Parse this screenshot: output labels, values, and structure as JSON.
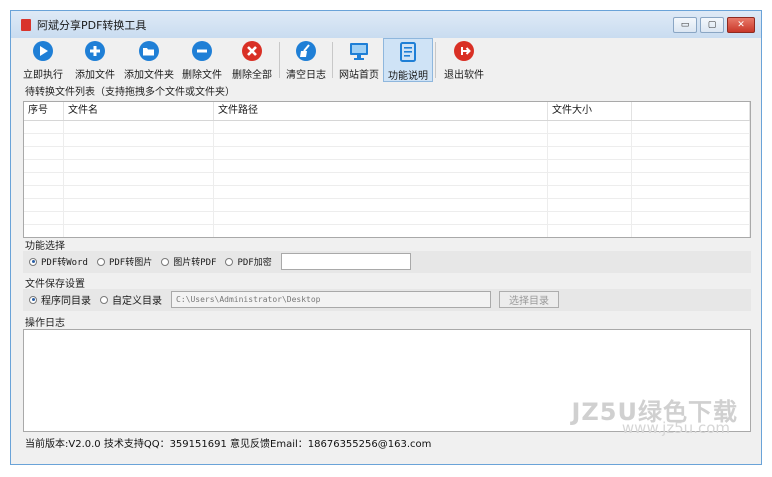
{
  "window": {
    "title": "阿斌分享PDF转换工具",
    "controls": {
      "minimize": "▭",
      "maximize": "▢",
      "close": "✕"
    }
  },
  "toolbar": {
    "items": [
      {
        "label": "立即执行",
        "icon": "play-icon",
        "color": "#1f7fd6"
      },
      {
        "label": "添加文件",
        "icon": "plus-icon",
        "color": "#1f7fd6"
      },
      {
        "label": "添加文件夹",
        "icon": "folder-icon",
        "color": "#1f7fd6"
      },
      {
        "label": "删除文件",
        "icon": "minus-icon",
        "color": "#1f7fd6"
      },
      {
        "label": "删除全部",
        "icon": "delete-all-icon",
        "color": "#d93025"
      },
      {
        "label": "清空日志",
        "icon": "broom-icon",
        "color": "#1f7fd6"
      },
      {
        "label": "网站首页",
        "icon": "monitor-icon",
        "color": "#1f7fd6"
      },
      {
        "label": "功能说明",
        "icon": "document-icon",
        "color": "#1f7fd6"
      },
      {
        "label": "退出软件",
        "icon": "exit-icon",
        "color": "#d93025"
      }
    ]
  },
  "filelist": {
    "label": "待转换文件列表（支持拖拽多个文件或文件夹）",
    "columns": [
      "序号",
      "文件名",
      "文件路径",
      "文件大小",
      ""
    ]
  },
  "function": {
    "label": "功能选择",
    "options": [
      "PDF转Word",
      "PDF转图片",
      "图片转PDF",
      "PDF加密"
    ],
    "selected": 0,
    "password_value": ""
  },
  "save": {
    "label": "文件保存设置",
    "options": [
      "程序同目录",
      "自定义目录"
    ],
    "selected": 0,
    "path": "C:\\Users\\Administrator\\Desktop",
    "choose_button": "选择目录"
  },
  "log": {
    "label": "操作日志"
  },
  "status": {
    "text": "当前版本:V2.0.0   技术支持QQ：359151691   意见反馈Email：18676355256@163.com"
  },
  "watermark": {
    "line1": "JZ5U绿色下载",
    "line2": "www.jz5u.com"
  }
}
